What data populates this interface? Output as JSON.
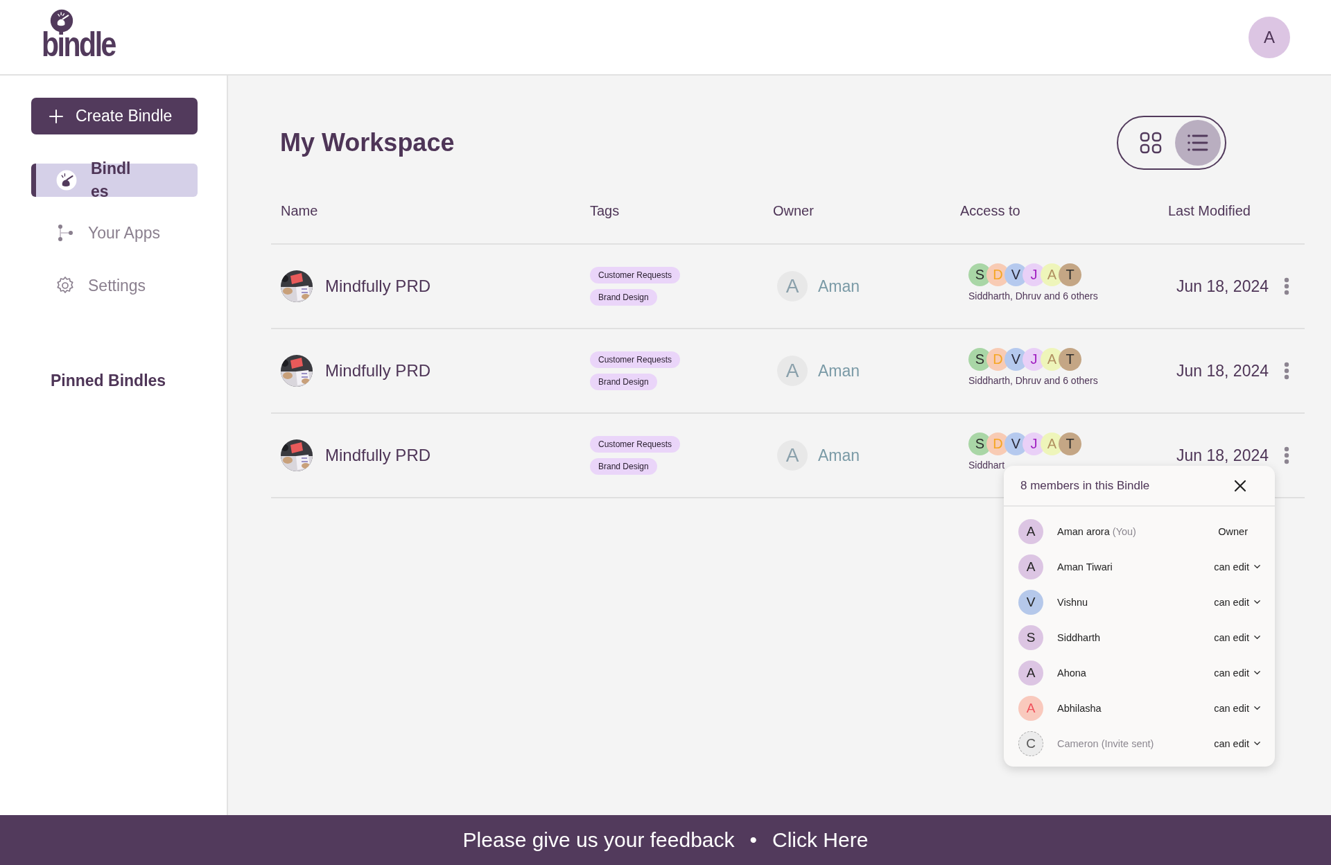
{
  "header": {
    "logo_text": "bindle",
    "user_initial": "A"
  },
  "sidebar": {
    "create_button": "Create Bindle",
    "items": [
      {
        "kind": "bindles",
        "label": "Bindles",
        "selected": true
      },
      {
        "kind": "apps",
        "label": "Your Apps",
        "selected": false
      },
      {
        "kind": "settings",
        "label": "Settings",
        "selected": false
      }
    ],
    "pinned_heading": "Pinned Bindles"
  },
  "workspace": {
    "title": "My Workspace",
    "view_toggle": [
      {
        "kind": "grid",
        "selected": false
      },
      {
        "kind": "list",
        "selected": true
      }
    ],
    "table": {
      "columns": [
        "Name",
        "Tags",
        "Owner",
        "Access to",
        "Last Modified"
      ],
      "rows": [
        {
          "name": "Mindfully PRD",
          "tags": [
            "Customer Requests",
            "Brand Design"
          ],
          "owner_initial": "A",
          "owner": "Aman",
          "access_avatars": [
            {
              "color": "#a9d6a6",
              "letter": {
                "text": "S"
              }
            },
            {
              "color": "#f8cbb4",
              "letter": {
                "text": "D",
                "color": "#f5a623"
              }
            },
            {
              "color": "#b5c9ee",
              "letter": {
                "text": "V",
                "color": "#2a2a3a"
              }
            },
            {
              "color": "#e9d0f7",
              "letter": {
                "text": "J",
                "color": "#a020c0"
              }
            },
            {
              "color": "#eef5ba",
              "letter": {
                "text": "A",
                "color": "#b09060"
              }
            },
            {
              "color": "#c4a685",
              "letter": {
                "text": "T"
              }
            }
          ],
          "access_text": "Siddharth, Dhruv and 6 others",
          "modified": "Jun 18, 2024"
        },
        {
          "name": "Mindfully PRD",
          "tags": [
            "Customer Requests",
            "Brand Design"
          ],
          "owner_initial": "A",
          "owner": "Aman",
          "access_avatars": [
            {
              "color": "#a9d6a6",
              "letter": {
                "text": "S"
              }
            },
            {
              "color": "#f8cbb4",
              "letter": {
                "text": "D",
                "color": "#f5a623"
              }
            },
            {
              "color": "#b5c9ee",
              "letter": {
                "text": "V",
                "color": "#2a2a3a"
              }
            },
            {
              "color": "#e9d0f7",
              "letter": {
                "text": "J",
                "color": "#a020c0"
              }
            },
            {
              "color": "#eef5ba",
              "letter": {
                "text": "A",
                "color": "#b09060"
              }
            },
            {
              "color": "#c4a685",
              "letter": {
                "text": "T"
              }
            }
          ],
          "access_text": "Siddharth, Dhruv and 6 others",
          "modified": "Jun 18, 2024"
        },
        {
          "name": "Mindfully PRD",
          "tags": [
            "Customer Requests",
            "Brand Design"
          ],
          "owner_initial": "A",
          "owner": "Aman",
          "access_avatars": [
            {
              "color": "#a9d6a6",
              "letter": {
                "text": "S"
              }
            },
            {
              "color": "#f8cbb4",
              "letter": {
                "text": "D",
                "color": "#f5a623"
              }
            },
            {
              "color": "#b5c9ee",
              "letter": {
                "text": "V",
                "color": "#2a2a3a"
              }
            },
            {
              "color": "#e9d0f7",
              "letter": {
                "text": "J",
                "color": "#a020c0"
              }
            },
            {
              "color": "#eef5ba",
              "letter": {
                "text": "A",
                "color": "#b09060"
              }
            },
            {
              "color": "#c4a685",
              "letter": {
                "text": "T"
              }
            }
          ],
          "access_text": "Siddhart",
          "modified": "Jun 18, 2024"
        }
      ]
    }
  },
  "members_popup": {
    "title": "8 members in this Bindle",
    "members": [
      {
        "color": "#dcc5e3",
        "letter": {
          "text": "A",
          "color": "#222222"
        },
        "name": "Aman arora",
        "suffix": "(You)",
        "role": "Owner",
        "kind": "owner",
        "pending": false
      },
      {
        "color": "#dcc5e3",
        "letter": {
          "text": "A",
          "color": "#222222"
        },
        "name": "Aman Tiwari",
        "role": "can edit",
        "kind": "editable",
        "pending": false
      },
      {
        "color": "#b5c8ea",
        "letter": {
          "text": "V",
          "color": "#222222"
        },
        "name": "Vishnu",
        "role": "can edit",
        "kind": "editable",
        "pending": false
      },
      {
        "color": "#dcc5e3",
        "letter": {
          "text": "S",
          "color": "#222222"
        },
        "name": "Siddharth",
        "role": "can edit",
        "kind": "editable",
        "pending": false
      },
      {
        "color": "#dcc5e3",
        "letter": {
          "text": "A",
          "color": "#222222"
        },
        "name": "Ahona",
        "role": "can edit",
        "kind": "editable",
        "pending": false
      },
      {
        "color": "#f9c9bd",
        "letter": {
          "text": "A",
          "color": "#f0505a"
        },
        "name": "Abhilasha",
        "role": "can edit",
        "kind": "editable",
        "pending": false
      },
      {
        "color": "#ececec",
        "letter": {
          "text": "C",
          "color": "#555555"
        },
        "name": "Cameron (Invite sent)",
        "role": "can edit",
        "kind": "editable",
        "pending": true
      }
    ]
  },
  "feedback_bar": {
    "text": "Please give us your feedback",
    "separator": "•",
    "link": "Click Here"
  }
}
